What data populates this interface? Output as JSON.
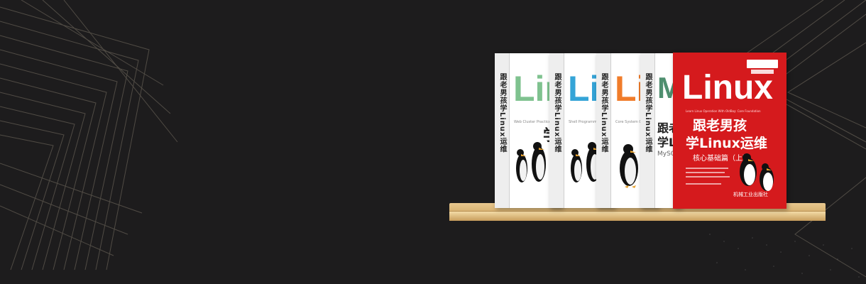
{
  "books": [
    {
      "spine": "跟老男孩学Linux运维",
      "cover_word": "Lin",
      "cover_cn": "学",
      "cover_sub": "Web Cluster Practice",
      "accent": "#7fc28f"
    },
    {
      "spine": "跟老男孩学Linux运维",
      "cover_word": "Li",
      "cover_sub": "Shell Programming",
      "accent": "#35a4d7"
    },
    {
      "spine": "跟老男孩学Linux运维",
      "cover_word": "Li",
      "cover_sub": "Core System Command",
      "accent": "#f07c2a"
    },
    {
      "spine": "跟老男孩学Linux运维",
      "cover_word": "M",
      "cover_cn_1": "跟老",
      "cover_cn_2": "学Li",
      "cover_cn_3": "MySQL入",
      "accent": "#4f8f6f"
    }
  ],
  "featured_book": {
    "title": "Linux",
    "line1": "跟老男孩",
    "line2": "学Linux运维",
    "tag": "核心基础篇（上）",
    "subtitle_en": "Learn Linux Operation With OldBoy: Core Foundation",
    "publisher": "机械工业出版社",
    "color": "#d51a1d"
  }
}
